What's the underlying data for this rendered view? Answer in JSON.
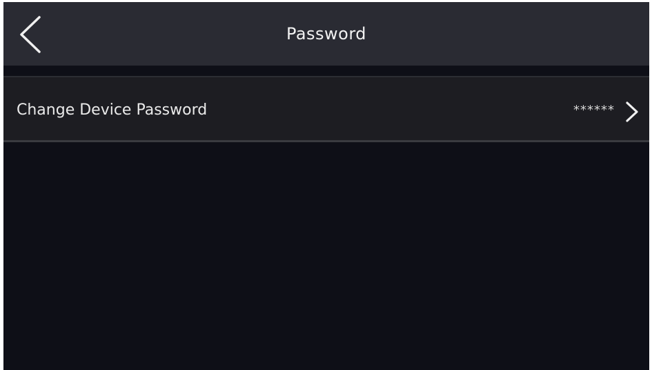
{
  "header": {
    "title": "Password"
  },
  "settings": {
    "items": [
      {
        "label": "Change Device Password",
        "value": "******"
      }
    ]
  },
  "icons": {
    "back": "chevron-left-icon",
    "row_chevron": "chevron-right-icon"
  },
  "colors": {
    "background": "#0e0f17",
    "header": "#2a2b33",
    "row": "#1d1d22",
    "text": "#eaeaea"
  }
}
